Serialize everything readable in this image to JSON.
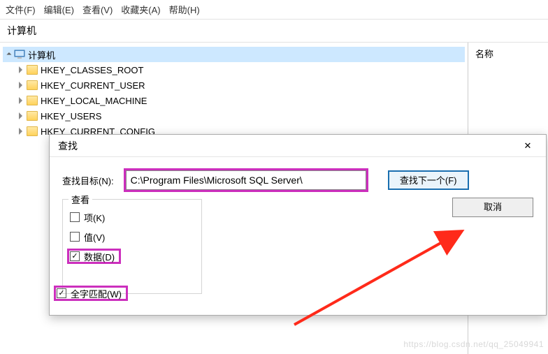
{
  "menu": {
    "file": "文件(F)",
    "edit": "编辑(E)",
    "view": "查看(V)",
    "favorites": "收藏夹(A)",
    "help": "帮助(H)"
  },
  "address": "计算机",
  "tree": {
    "root": "计算机",
    "items": [
      "HKEY_CLASSES_ROOT",
      "HKEY_CURRENT_USER",
      "HKEY_LOCAL_MACHINE",
      "HKEY_USERS",
      "HKEY_CURRENT_CONFIG"
    ]
  },
  "rightpane": {
    "header": "名称"
  },
  "dialog": {
    "title": "查找",
    "findwhat_label": "查找目标(N):",
    "findwhat_value": "C:\\Program Files\\Microsoft SQL Server\\",
    "btn_next": "查找下一个(F)",
    "btn_cancel": "取消",
    "group_label": "查看",
    "chk_keys": "项(K)",
    "chk_values": "值(V)",
    "chk_data": "数据(D)",
    "chk_match": "全字匹配(W)",
    "checked": {
      "keys": false,
      "values": false,
      "data": true,
      "match": true
    }
  },
  "watermark": "https://blog.csdn.net/qq_25049941"
}
